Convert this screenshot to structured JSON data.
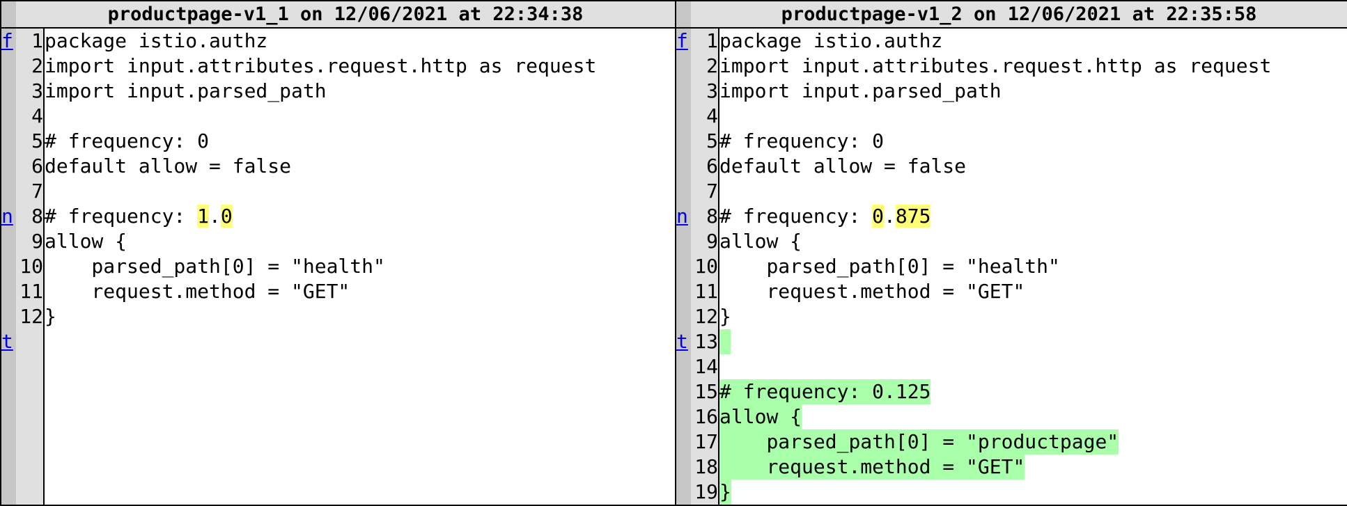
{
  "left": {
    "title": "productpage-v1_1 on 12/06/2021 at 22:34:38",
    "lines": [
      {
        "n": "1",
        "t": "package istio.authz"
      },
      {
        "n": "2",
        "t": "import input.attributes.request.http as request"
      },
      {
        "n": "3",
        "t": "import input.parsed_path"
      },
      {
        "n": "4",
        "t": ""
      },
      {
        "n": "5",
        "t": "# frequency: 0"
      },
      {
        "n": "6",
        "t": "default allow = false"
      },
      {
        "n": "7",
        "t": ""
      },
      {
        "n": "8",
        "pre": "# frequency: ",
        "c1": "1",
        "mid": ".",
        "c2": "0"
      },
      {
        "n": "9",
        "t": "allow {"
      },
      {
        "n": "10",
        "t": "    parsed_path[0] = \"health\""
      },
      {
        "n": "11",
        "t": "    request.method = \"GET\""
      },
      {
        "n": "12",
        "t": "}"
      }
    ]
  },
  "right": {
    "title": "productpage-v1_2 on 12/06/2021 at 22:35:58",
    "lines": [
      {
        "n": "1",
        "t": "package istio.authz"
      },
      {
        "n": "2",
        "t": "import input.attributes.request.http as request"
      },
      {
        "n": "3",
        "t": "import input.parsed_path"
      },
      {
        "n": "4",
        "t": ""
      },
      {
        "n": "5",
        "t": "# frequency: 0"
      },
      {
        "n": "6",
        "t": "default allow = false"
      },
      {
        "n": "7",
        "t": ""
      },
      {
        "n": "8",
        "pre": "# frequency: ",
        "c1": "0",
        "mid": ".",
        "c2": "875"
      },
      {
        "n": "9",
        "t": "allow {"
      },
      {
        "n": "10",
        "t": "    parsed_path[0] = \"health\""
      },
      {
        "n": "11",
        "t": "    request.method = \"GET\""
      },
      {
        "n": "12",
        "t": "}"
      },
      {
        "n": "13",
        "t": " "
      },
      {
        "n": "14",
        "t": ""
      },
      {
        "n": "15",
        "t": "# frequency: 0.125"
      },
      {
        "n": "16",
        "t": "allow {"
      },
      {
        "n": "17",
        "t": "    parsed_path[0] = \"productpage\""
      },
      {
        "n": "18",
        "t": "    request.method = \"GET\""
      },
      {
        "n": "19",
        "t": "}"
      }
    ]
  },
  "nav": {
    "first": "f",
    "next": "n",
    "top": "t"
  },
  "colors": {
    "changed": "#ffff77",
    "added": "#aaffaa",
    "header": "#e0e0e0",
    "gutter": "#c6c6c6"
  }
}
